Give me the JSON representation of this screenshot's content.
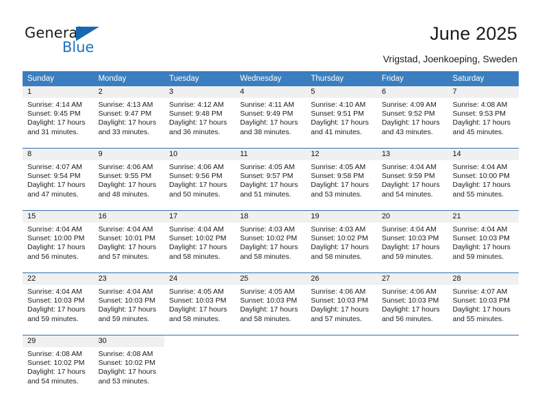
{
  "brand": {
    "name_part1": "General",
    "name_part2": "Blue",
    "logo_icon": "triangle-flag-icon",
    "accent_color": "#1668b3"
  },
  "header": {
    "title": "June 2025",
    "subtitle": "Vrigstad, Joenkoeping, Sweden"
  },
  "calendar": {
    "header_bg": "#3a7ebf",
    "daynum_bg": "#f0f0f0",
    "row_divider_color": "#2f6fab",
    "weekdays": [
      "Sunday",
      "Monday",
      "Tuesday",
      "Wednesday",
      "Thursday",
      "Friday",
      "Saturday"
    ],
    "weeks": [
      [
        {
          "day": "1",
          "sunrise": "Sunrise: 4:14 AM",
          "sunset": "Sunset: 9:45 PM",
          "daylight": "Daylight: 17 hours and 31 minutes."
        },
        {
          "day": "2",
          "sunrise": "Sunrise: 4:13 AM",
          "sunset": "Sunset: 9:47 PM",
          "daylight": "Daylight: 17 hours and 33 minutes."
        },
        {
          "day": "3",
          "sunrise": "Sunrise: 4:12 AM",
          "sunset": "Sunset: 9:48 PM",
          "daylight": "Daylight: 17 hours and 36 minutes."
        },
        {
          "day": "4",
          "sunrise": "Sunrise: 4:11 AM",
          "sunset": "Sunset: 9:49 PM",
          "daylight": "Daylight: 17 hours and 38 minutes."
        },
        {
          "day": "5",
          "sunrise": "Sunrise: 4:10 AM",
          "sunset": "Sunset: 9:51 PM",
          "daylight": "Daylight: 17 hours and 41 minutes."
        },
        {
          "day": "6",
          "sunrise": "Sunrise: 4:09 AM",
          "sunset": "Sunset: 9:52 PM",
          "daylight": "Daylight: 17 hours and 43 minutes."
        },
        {
          "day": "7",
          "sunrise": "Sunrise: 4:08 AM",
          "sunset": "Sunset: 9:53 PM",
          "daylight": "Daylight: 17 hours and 45 minutes."
        }
      ],
      [
        {
          "day": "8",
          "sunrise": "Sunrise: 4:07 AM",
          "sunset": "Sunset: 9:54 PM",
          "daylight": "Daylight: 17 hours and 47 minutes."
        },
        {
          "day": "9",
          "sunrise": "Sunrise: 4:06 AM",
          "sunset": "Sunset: 9:55 PM",
          "daylight": "Daylight: 17 hours and 48 minutes."
        },
        {
          "day": "10",
          "sunrise": "Sunrise: 4:06 AM",
          "sunset": "Sunset: 9:56 PM",
          "daylight": "Daylight: 17 hours and 50 minutes."
        },
        {
          "day": "11",
          "sunrise": "Sunrise: 4:05 AM",
          "sunset": "Sunset: 9:57 PM",
          "daylight": "Daylight: 17 hours and 51 minutes."
        },
        {
          "day": "12",
          "sunrise": "Sunrise: 4:05 AM",
          "sunset": "Sunset: 9:58 PM",
          "daylight": "Daylight: 17 hours and 53 minutes."
        },
        {
          "day": "13",
          "sunrise": "Sunrise: 4:04 AM",
          "sunset": "Sunset: 9:59 PM",
          "daylight": "Daylight: 17 hours and 54 minutes."
        },
        {
          "day": "14",
          "sunrise": "Sunrise: 4:04 AM",
          "sunset": "Sunset: 10:00 PM",
          "daylight": "Daylight: 17 hours and 55 minutes."
        }
      ],
      [
        {
          "day": "15",
          "sunrise": "Sunrise: 4:04 AM",
          "sunset": "Sunset: 10:00 PM",
          "daylight": "Daylight: 17 hours and 56 minutes."
        },
        {
          "day": "16",
          "sunrise": "Sunrise: 4:04 AM",
          "sunset": "Sunset: 10:01 PM",
          "daylight": "Daylight: 17 hours and 57 minutes."
        },
        {
          "day": "17",
          "sunrise": "Sunrise: 4:04 AM",
          "sunset": "Sunset: 10:02 PM",
          "daylight": "Daylight: 17 hours and 58 minutes."
        },
        {
          "day": "18",
          "sunrise": "Sunrise: 4:03 AM",
          "sunset": "Sunset: 10:02 PM",
          "daylight": "Daylight: 17 hours and 58 minutes."
        },
        {
          "day": "19",
          "sunrise": "Sunrise: 4:03 AM",
          "sunset": "Sunset: 10:02 PM",
          "daylight": "Daylight: 17 hours and 58 minutes."
        },
        {
          "day": "20",
          "sunrise": "Sunrise: 4:04 AM",
          "sunset": "Sunset: 10:03 PM",
          "daylight": "Daylight: 17 hours and 59 minutes."
        },
        {
          "day": "21",
          "sunrise": "Sunrise: 4:04 AM",
          "sunset": "Sunset: 10:03 PM",
          "daylight": "Daylight: 17 hours and 59 minutes."
        }
      ],
      [
        {
          "day": "22",
          "sunrise": "Sunrise: 4:04 AM",
          "sunset": "Sunset: 10:03 PM",
          "daylight": "Daylight: 17 hours and 59 minutes."
        },
        {
          "day": "23",
          "sunrise": "Sunrise: 4:04 AM",
          "sunset": "Sunset: 10:03 PM",
          "daylight": "Daylight: 17 hours and 59 minutes."
        },
        {
          "day": "24",
          "sunrise": "Sunrise: 4:05 AM",
          "sunset": "Sunset: 10:03 PM",
          "daylight": "Daylight: 17 hours and 58 minutes."
        },
        {
          "day": "25",
          "sunrise": "Sunrise: 4:05 AM",
          "sunset": "Sunset: 10:03 PM",
          "daylight": "Daylight: 17 hours and 58 minutes."
        },
        {
          "day": "26",
          "sunrise": "Sunrise: 4:06 AM",
          "sunset": "Sunset: 10:03 PM",
          "daylight": "Daylight: 17 hours and 57 minutes."
        },
        {
          "day": "27",
          "sunrise": "Sunrise: 4:06 AM",
          "sunset": "Sunset: 10:03 PM",
          "daylight": "Daylight: 17 hours and 56 minutes."
        },
        {
          "day": "28",
          "sunrise": "Sunrise: 4:07 AM",
          "sunset": "Sunset: 10:03 PM",
          "daylight": "Daylight: 17 hours and 55 minutes."
        }
      ],
      [
        {
          "day": "29",
          "sunrise": "Sunrise: 4:08 AM",
          "sunset": "Sunset: 10:02 PM",
          "daylight": "Daylight: 17 hours and 54 minutes."
        },
        {
          "day": "30",
          "sunrise": "Sunrise: 4:08 AM",
          "sunset": "Sunset: 10:02 PM",
          "daylight": "Daylight: 17 hours and 53 minutes."
        },
        {
          "day": "",
          "sunrise": "",
          "sunset": "",
          "daylight": ""
        },
        {
          "day": "",
          "sunrise": "",
          "sunset": "",
          "daylight": ""
        },
        {
          "day": "",
          "sunrise": "",
          "sunset": "",
          "daylight": ""
        },
        {
          "day": "",
          "sunrise": "",
          "sunset": "",
          "daylight": ""
        },
        {
          "day": "",
          "sunrise": "",
          "sunset": "",
          "daylight": ""
        }
      ]
    ]
  }
}
